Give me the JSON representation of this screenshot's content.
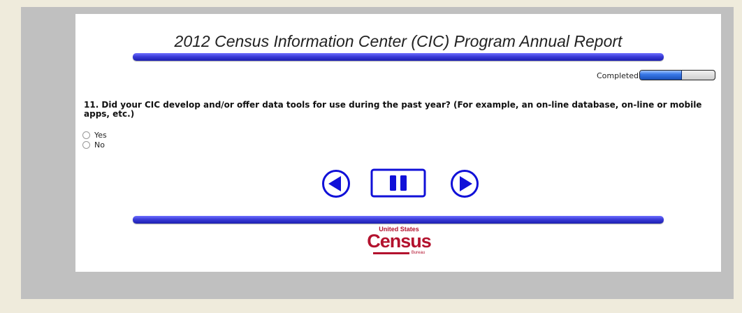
{
  "survey": {
    "title": "2012 Census Information Center (CIC) Program Annual Report"
  },
  "progress": {
    "label": "Completed",
    "value": 0.55
  },
  "question": {
    "text": "11. Did your CIC develop and/or offer data tools for use during the past year? (For example, an on-line database, on-line or mobile apps, etc.)",
    "options": [
      {
        "label": "Yes",
        "selected": false
      },
      {
        "label": "No",
        "selected": false
      }
    ]
  },
  "navigation": {
    "back_icon": "back-arrow-icon",
    "pause_icon": "pause-icon",
    "next_icon": "next-arrow-icon"
  },
  "logo": {
    "top": "United States",
    "main": "Census",
    "bottom": "Bureau"
  },
  "colors": {
    "page_bg": "#efebdc",
    "frame_bg": "#c0c0c0",
    "rule_blue": "#3b3cd8",
    "nav_blue": "#1010d8",
    "logo_red": "#b3122e"
  }
}
